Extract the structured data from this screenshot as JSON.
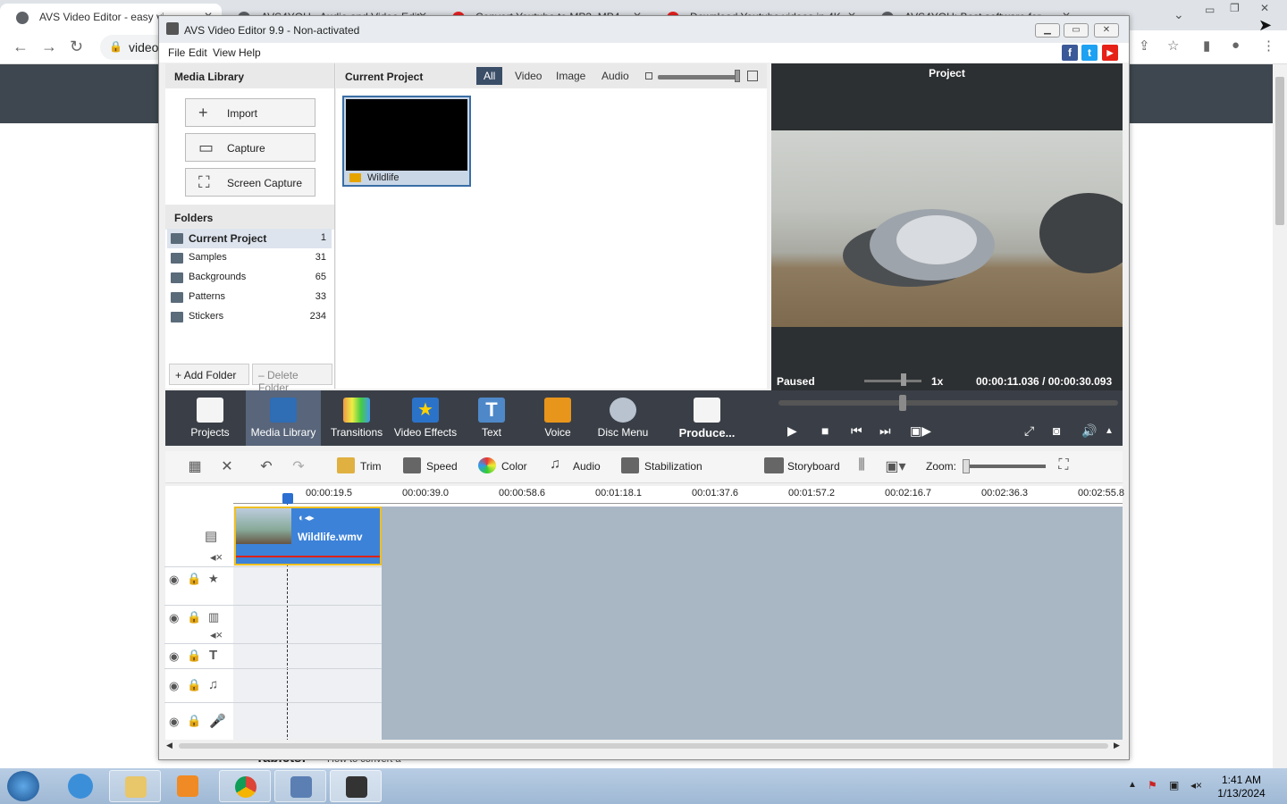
{
  "browser": {
    "tabs": [
      {
        "label": "AVS Video Editor - easy vi"
      },
      {
        "label": "AVS4YOU - Audio and Video Edito"
      },
      {
        "label": "Convert Youtube to MP3, MP4"
      },
      {
        "label": "Download Youtube videos in 4K"
      },
      {
        "label": "AVS4YOU: Best software for"
      }
    ],
    "url": "video",
    "page_heading": "Tablets:",
    "page_snippet": "How to convert a"
  },
  "app": {
    "title": "AVS Video Editor 9.9 - Non-activated",
    "menu": [
      "File",
      "Edit",
      "View",
      "Help"
    ],
    "social": [
      "f",
      "t",
      "▶"
    ],
    "colors": {
      "accent": "#3b4e68",
      "toolbar": "#3a3f47",
      "clip": "#3c82d8",
      "facebook": "#3b5998",
      "twitter": "#1da1f2",
      "youtube": "#e62117"
    }
  },
  "media_library": {
    "title": "Media Library",
    "buttons": {
      "import": "Import",
      "capture": "Capture",
      "screen_capture": "Screen Capture"
    },
    "folders_title": "Folders",
    "folders": [
      {
        "name": "Current Project",
        "count": "1"
      },
      {
        "name": "Samples",
        "count": "31"
      },
      {
        "name": "Backgrounds",
        "count": "65"
      },
      {
        "name": "Patterns",
        "count": "33"
      },
      {
        "name": "Stickers",
        "count": "234"
      }
    ],
    "add_folder": "Add Folder",
    "delete_folder": "Delete Folder"
  },
  "current_project": {
    "title": "Current Project",
    "filters": [
      "All",
      "Video",
      "Image",
      "Audio"
    ],
    "items": [
      {
        "name": "Wildlife"
      }
    ]
  },
  "preview": {
    "title": "Project",
    "status": "Paused",
    "speed": "1x",
    "time": "00:00:11.036 / 00:00:30.093",
    "position_fraction": 0.367
  },
  "toolbar": {
    "items": [
      {
        "label": "Projects",
        "icon": "clapperboard-icon"
      },
      {
        "label": "Media Library",
        "icon": "film-icon"
      },
      {
        "label": "Transitions",
        "icon": "transitions-icon"
      },
      {
        "label": "Video Effects",
        "icon": "star-icon"
      },
      {
        "label": "Text",
        "icon": "text-icon"
      },
      {
        "label": "Voice",
        "icon": "microphone-icon"
      },
      {
        "label": "Disc Menu",
        "icon": "disc-icon"
      },
      {
        "label": "Produce...",
        "icon": "produce-icon"
      }
    ],
    "selected": "Media Library"
  },
  "editbar": {
    "trim": "Trim",
    "speed": "Speed",
    "color": "Color",
    "audio": "Audio",
    "stabilization": "Stabilization",
    "storyboard": "Storyboard",
    "zoom": "Zoom:"
  },
  "timeline": {
    "ticks": [
      "00:00:19.5",
      "00:00:39.0",
      "00:00:58.6",
      "00:01:18.1",
      "00:01:37.6",
      "00:01:57.2",
      "00:02:16.7",
      "00:02:36.3",
      "00:02:55.8"
    ],
    "clip_name": "Wildlife.wmv"
  },
  "taskbar": {
    "time": "1:41 AM",
    "date": "1/13/2024"
  }
}
